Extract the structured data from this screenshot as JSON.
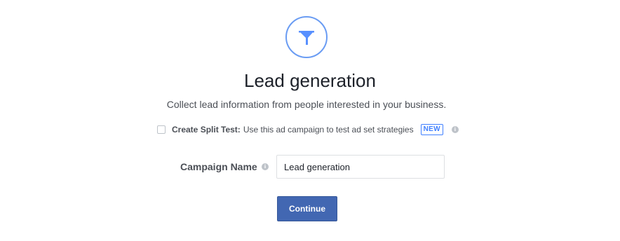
{
  "objective": {
    "icon": "funnel-icon",
    "title": "Lead generation",
    "description": "Collect lead information from people interested in your business."
  },
  "split_test": {
    "checked": false,
    "label": "Create Split Test:",
    "description": "Use this ad campaign to test ad set strategies",
    "badge": "NEW",
    "info_icon": "info-icon"
  },
  "campaign_name": {
    "label": "Campaign Name",
    "value": "Lead generation",
    "info_icon": "info-icon"
  },
  "continue_button": {
    "label": "Continue"
  },
  "colors": {
    "accent": "#4267b2",
    "icon_blue": "#5890ff",
    "badge_blue": "#4080ff"
  }
}
